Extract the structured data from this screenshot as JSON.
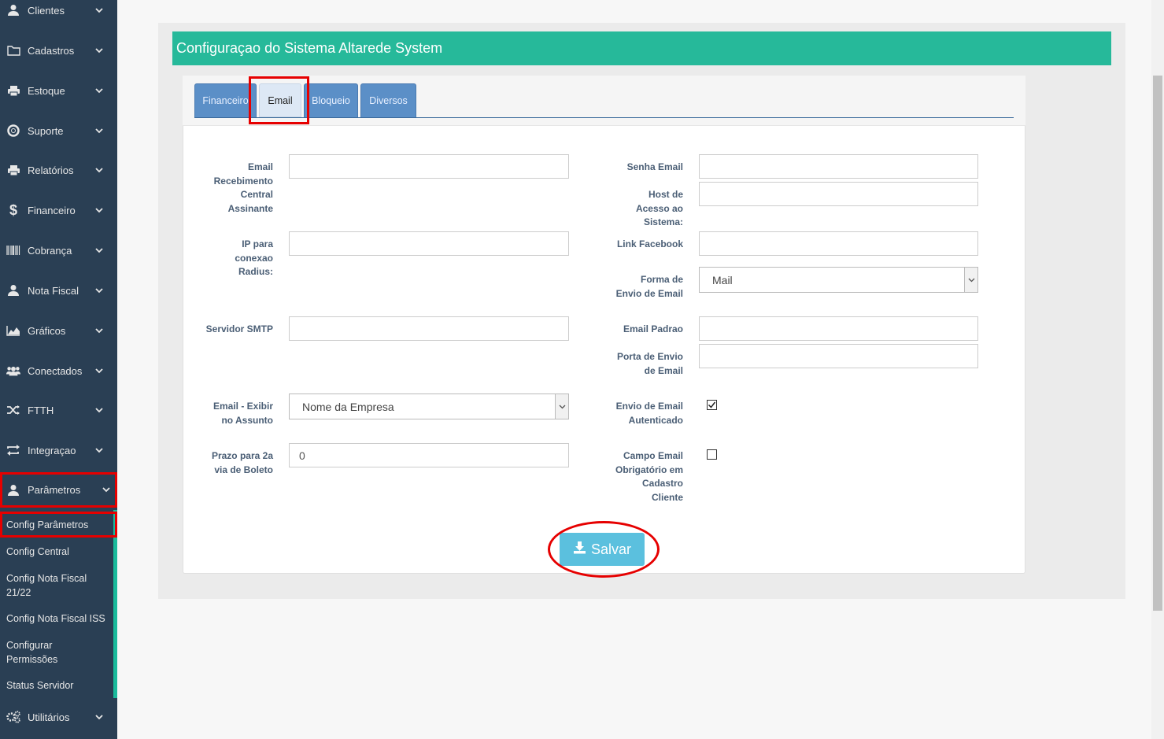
{
  "sidebar": {
    "items": [
      {
        "label": "Clientes",
        "icon": "user-icon"
      },
      {
        "label": "Cadastros",
        "icon": "folder-icon"
      },
      {
        "label": "Estoque",
        "icon": "printer-icon"
      },
      {
        "label": "Suporte",
        "icon": "lifebuoy-icon"
      },
      {
        "label": "Relatórios",
        "icon": "printer-icon"
      },
      {
        "label": "Financeiro",
        "icon": "dollar-icon"
      },
      {
        "label": "Cobrança",
        "icon": "barcode-icon"
      },
      {
        "label": "Nota Fiscal",
        "icon": "user-icon"
      },
      {
        "label": "Gráficos",
        "icon": "area-chart-icon"
      },
      {
        "label": "Conectados",
        "icon": "users-icon"
      },
      {
        "label": "FTTH",
        "icon": "shuffle-icon"
      },
      {
        "label": "Integraçao",
        "icon": "exchange-icon"
      },
      {
        "label": "Parâmetros",
        "icon": "user-icon"
      },
      {
        "label": "Utilitários",
        "icon": "gears-icon"
      }
    ],
    "submenu": [
      "Config Parâmetros",
      "Config Central",
      "Config Nota Fiscal 21/22",
      "Config Nota Fiscal ISS",
      "Configurar Permissões",
      "Status Servidor"
    ]
  },
  "header": {
    "title": "Configuraçao do Sistema Altarede System"
  },
  "tabs": [
    "Financeiro",
    "Email",
    "Bloqueio",
    "Diversos"
  ],
  "active_tab": "Email",
  "form": {
    "email_recebimento_label": "Email Recebimento Central Assinante",
    "email_recebimento_value": "",
    "ip_radius_label": "IP para conexao Radius:",
    "ip_radius_value": "",
    "servidor_smtp_label": "Servidor SMTP",
    "servidor_smtp_value": "",
    "email_assunto_label": "Email - Exibir no Assunto",
    "email_assunto_value": "Nome da Empresa",
    "prazo_boleto_label": "Prazo para 2a via de Boleto",
    "prazo_boleto_value": "0",
    "senha_email_label": "Senha Email",
    "senha_email_value": "",
    "host_acesso_label": "Host de Acesso ao Sistema:",
    "host_acesso_value": "",
    "link_facebook_label": "Link Facebook",
    "link_facebook_value": "",
    "forma_envio_label": "Forma de Envio de Email",
    "forma_envio_value": "Mail",
    "email_padrao_label": "Email Padrao",
    "email_padrao_value": "",
    "porta_envio_label": "Porta de Envio de Email",
    "porta_envio_value": "",
    "envio_autenticado_label": "Envio de Email Autenticado",
    "envio_autenticado_checked": true,
    "campo_obrigatorio_label": "Campo Email Obrigatório em Cadastro Cliente",
    "campo_obrigatorio_checked": false
  },
  "save_button": {
    "label": "Salvar",
    "icon": "download-icon"
  },
  "colors": {
    "sidebar": "#2a3f54",
    "accent": "#26b99a",
    "tab": "#5b8fc7",
    "save": "#5bc0de",
    "highlight": "#e60000"
  }
}
